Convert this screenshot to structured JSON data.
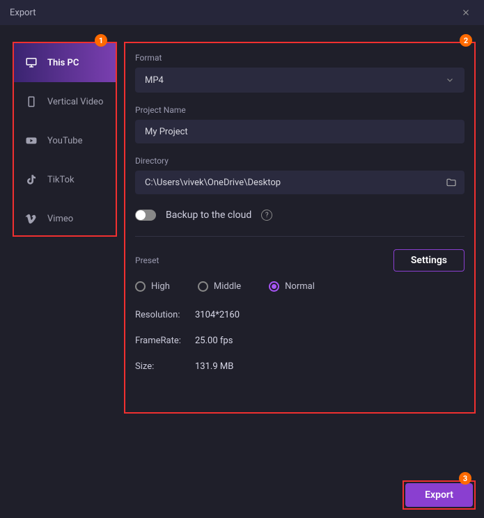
{
  "window": {
    "title": "Export"
  },
  "sidebar": {
    "items": [
      {
        "label": "This PC"
      },
      {
        "label": "Vertical Video"
      },
      {
        "label": "YouTube"
      },
      {
        "label": "TikTok"
      },
      {
        "label": "Vimeo"
      }
    ]
  },
  "main": {
    "format_label": "Format",
    "format_value": "MP4",
    "project_label": "Project Name",
    "project_value": "My Project",
    "directory_label": "Directory",
    "directory_value": "C:\\Users\\vivek\\OneDrive\\Desktop",
    "backup_label": "Backup to the cloud",
    "preset_label": "Preset",
    "settings_label": "Settings",
    "radios": {
      "high": "High",
      "middle": "Middle",
      "normal": "Normal"
    },
    "info": {
      "resolution_label": "Resolution:",
      "resolution_value": "3104*2160",
      "framerate_label": "FrameRate:",
      "framerate_value": "25.00 fps",
      "size_label": "Size:",
      "size_value": "131.9 MB"
    }
  },
  "export_label": "Export",
  "badges": {
    "b1": "1",
    "b2": "2",
    "b3": "3"
  }
}
